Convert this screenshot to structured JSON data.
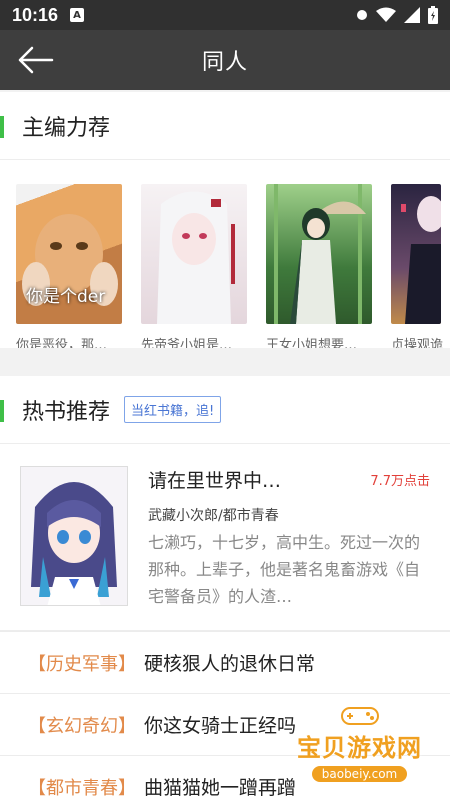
{
  "status": {
    "time": "10:16",
    "notif_letter": "A"
  },
  "appbar": {
    "title": "同人"
  },
  "editor": {
    "title": "主编力荐",
    "cards": [
      {
        "caption": "你是恶役，那…",
        "overlay": "你是个der",
        "colors": [
          "#e8a25a",
          "#c47a3a"
        ]
      },
      {
        "caption": "先帝爷小姐是…",
        "overlay": "",
        "colors": [
          "#f3eef0",
          "#d9c9cf"
        ]
      },
      {
        "caption": "王女小姐想要…",
        "overlay": "",
        "colors": [
          "#3f7a3c",
          "#8fbf6a"
        ]
      },
      {
        "caption": "贞操观诡",
        "overlay": "",
        "colors": [
          "#5a4a7a",
          "#e9a24a"
        ]
      }
    ]
  },
  "hot": {
    "title": "热书推荐",
    "tag": "当红书籍，追!",
    "book": {
      "name": "请在里世界中…",
      "clicks": "7.7万点击",
      "author": "武藏小次郎/都市青春",
      "desc": "七濑巧，十七岁，高中生。死过一次的那种。上辈子，他是著名鬼畜游戏《自宅警备员》的人渣…"
    },
    "list": [
      {
        "cat": "【历史军事】",
        "name": "硬核狠人的退休日常"
      },
      {
        "cat": "【玄幻奇幻】",
        "name": "你这女骑士正经吗"
      },
      {
        "cat": "【都市青春】",
        "name": "曲猫猫她一蹭再蹭"
      }
    ]
  },
  "watermark": {
    "main": "宝贝游戏网",
    "sub": "baobeiy.com"
  }
}
